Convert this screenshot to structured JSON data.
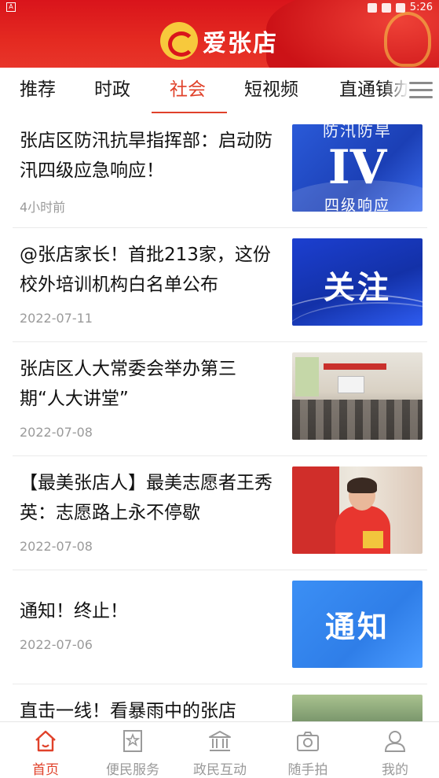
{
  "status_bar": {
    "time": "5:26"
  },
  "header": {
    "app_name": "爱张店"
  },
  "tabs": [
    "推荐",
    "时政",
    "社会",
    "短视频",
    "直通镇办"
  ],
  "active_tab": "社会",
  "news": [
    {
      "title": "张店区防汛抗旱指挥部：启动防汛四级应急响应！",
      "meta": "4小时前",
      "thumb_text": [
        "防汛防旱",
        "IV",
        "四级响应"
      ]
    },
    {
      "title": "@张店家长！首批213家，这份校外培训机构白名单公布",
      "meta": "2022-07-11",
      "thumb_text": [
        "关注"
      ]
    },
    {
      "title": "张店区人大常委会举办第三期“人大讲堂”",
      "meta": "2022-07-08"
    },
    {
      "title": "【最美张店人】最美志愿者王秀英：志愿路上永不停歇",
      "meta": "2022-07-08"
    },
    {
      "title": "通知！终止！",
      "meta": "2022-07-06",
      "thumb_text": [
        "通知"
      ]
    },
    {
      "title": "直击一线！看暴雨中的张店",
      "meta": ""
    }
  ],
  "bottom_nav": [
    {
      "label": "首页",
      "icon": "home-icon",
      "active": true
    },
    {
      "label": "便民服务",
      "icon": "bookmark-star-icon",
      "active": false
    },
    {
      "label": "政民互动",
      "icon": "government-building-icon",
      "active": false
    },
    {
      "label": "随手拍",
      "icon": "camera-icon",
      "active": false
    },
    {
      "label": "我的",
      "icon": "user-icon",
      "active": false
    }
  ],
  "colors": {
    "brand_red": "#d9141b",
    "accent": "#e0412a",
    "muted": "#9a9a9a"
  }
}
